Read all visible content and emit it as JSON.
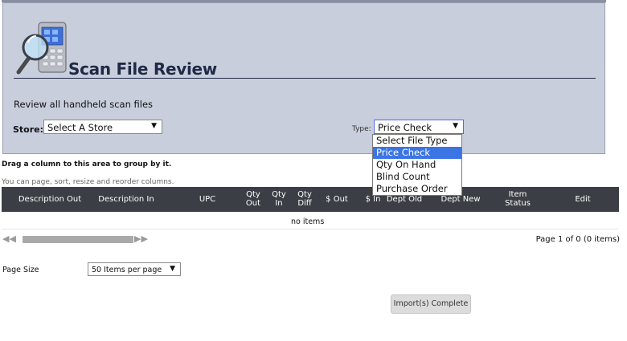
{
  "header": {
    "title": "Scan File Review",
    "subtitle": "Review all handheld scan files",
    "logo_icon": "handheld-scanner-magnifier-icon"
  },
  "filters": {
    "store_label": "Store:",
    "store_value": "Select A Store",
    "type_label": "Type:",
    "type_value": "Price Check",
    "type_options": [
      "Select File Type",
      "Price Check",
      "Qty On Hand",
      "Blind Count",
      "Purchase Order"
    ],
    "type_highlighted": "Price Check"
  },
  "grid": {
    "group_hint": "Drag a column to this area to group by it.",
    "page_hint": "You can page, sort, resize and reorder columns.",
    "columns": [
      [
        "Description Out"
      ],
      [
        "Description In"
      ],
      [
        "UPC"
      ],
      [
        "Qty",
        "Out"
      ],
      [
        "Qty",
        "In"
      ],
      [
        "Qty",
        "Diff"
      ],
      [
        "$ Out"
      ],
      [
        "$ In"
      ],
      [
        "Dept Old"
      ],
      [
        "Dept New"
      ],
      [
        "Item",
        "Status"
      ],
      [
        "Edit"
      ]
    ],
    "empty_text": "no items"
  },
  "pager": {
    "info": "Page 1 of 0 (0 items)",
    "first_icon": "first-page-icon",
    "prev_icon": "prev-page-icon",
    "next_icon": "next-page-icon",
    "last_icon": "last-page-icon"
  },
  "page_size": {
    "label": "Page Size",
    "value": "50 Items per page"
  },
  "actions": {
    "import_complete": "Import(s) Complete"
  },
  "colors": {
    "panel_bg": "#c9cedd",
    "title": "#1f2a44",
    "grid_header": "#3b3e44",
    "highlight": "#3b74e3"
  }
}
